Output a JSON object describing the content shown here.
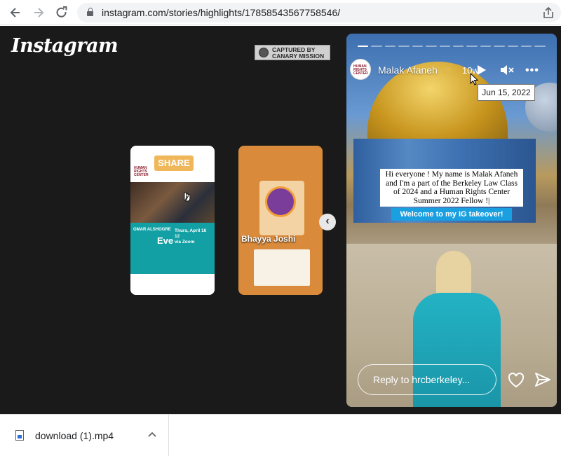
{
  "browser": {
    "url": "instagram.com/stories/highlights/17858543567758546/"
  },
  "instagram": {
    "logo_text": "Instagram",
    "watermark": {
      "line1": "CAPTURED BY",
      "line2": "CANARY MISSION"
    },
    "previews": [
      {
        "share_label": "SHARE",
        "org_line1": "HUMAN",
        "org_line2": "RIGHTS",
        "org_line3": "CENTER",
        "name": "OMAR ALSHOGRE",
        "event": "Eve",
        "date_line1": "Thurs, April 16",
        "date_line2": "12",
        "date_line3": "via Zoom"
      },
      {
        "name": "Bhayya Joshi"
      }
    ],
    "story": {
      "author": "Malak Afaneh",
      "avatar_line1": "HUMAN",
      "avatar_line2": "RIGHTS",
      "avatar_line3": "CENTER",
      "time": "10w",
      "tooltip_date": "Jun 15, 2022",
      "caption": "Hi everyone ! My name is Malak Afaneh and I'm a part of the Berkeley Law Class of 2024 and a Human Rights Center Summer 2022 Fellow !|",
      "banner": "Welcome to my IG takeover!",
      "reply_placeholder": "Reply to hrcberkeley..."
    }
  },
  "download_bar": {
    "filename": "download (1).mp4"
  },
  "icons": {
    "back": "arrow-left-icon",
    "forward": "arrow-right-icon",
    "reload": "reload-icon",
    "lock": "lock-icon",
    "share": "share-icon",
    "play": "play-icon",
    "mute": "mute-icon",
    "more": "more-icon",
    "heart": "heart-icon",
    "send": "send-icon",
    "prev": "chevron-left-icon",
    "file": "video-file-icon",
    "chevron": "chevron-up-icon"
  },
  "colors": {
    "stage_bg": "#1a1a1a",
    "banner_blue": "#1a9fe0",
    "share_orange": "#f0b75a",
    "teal": "#13a0a4"
  }
}
